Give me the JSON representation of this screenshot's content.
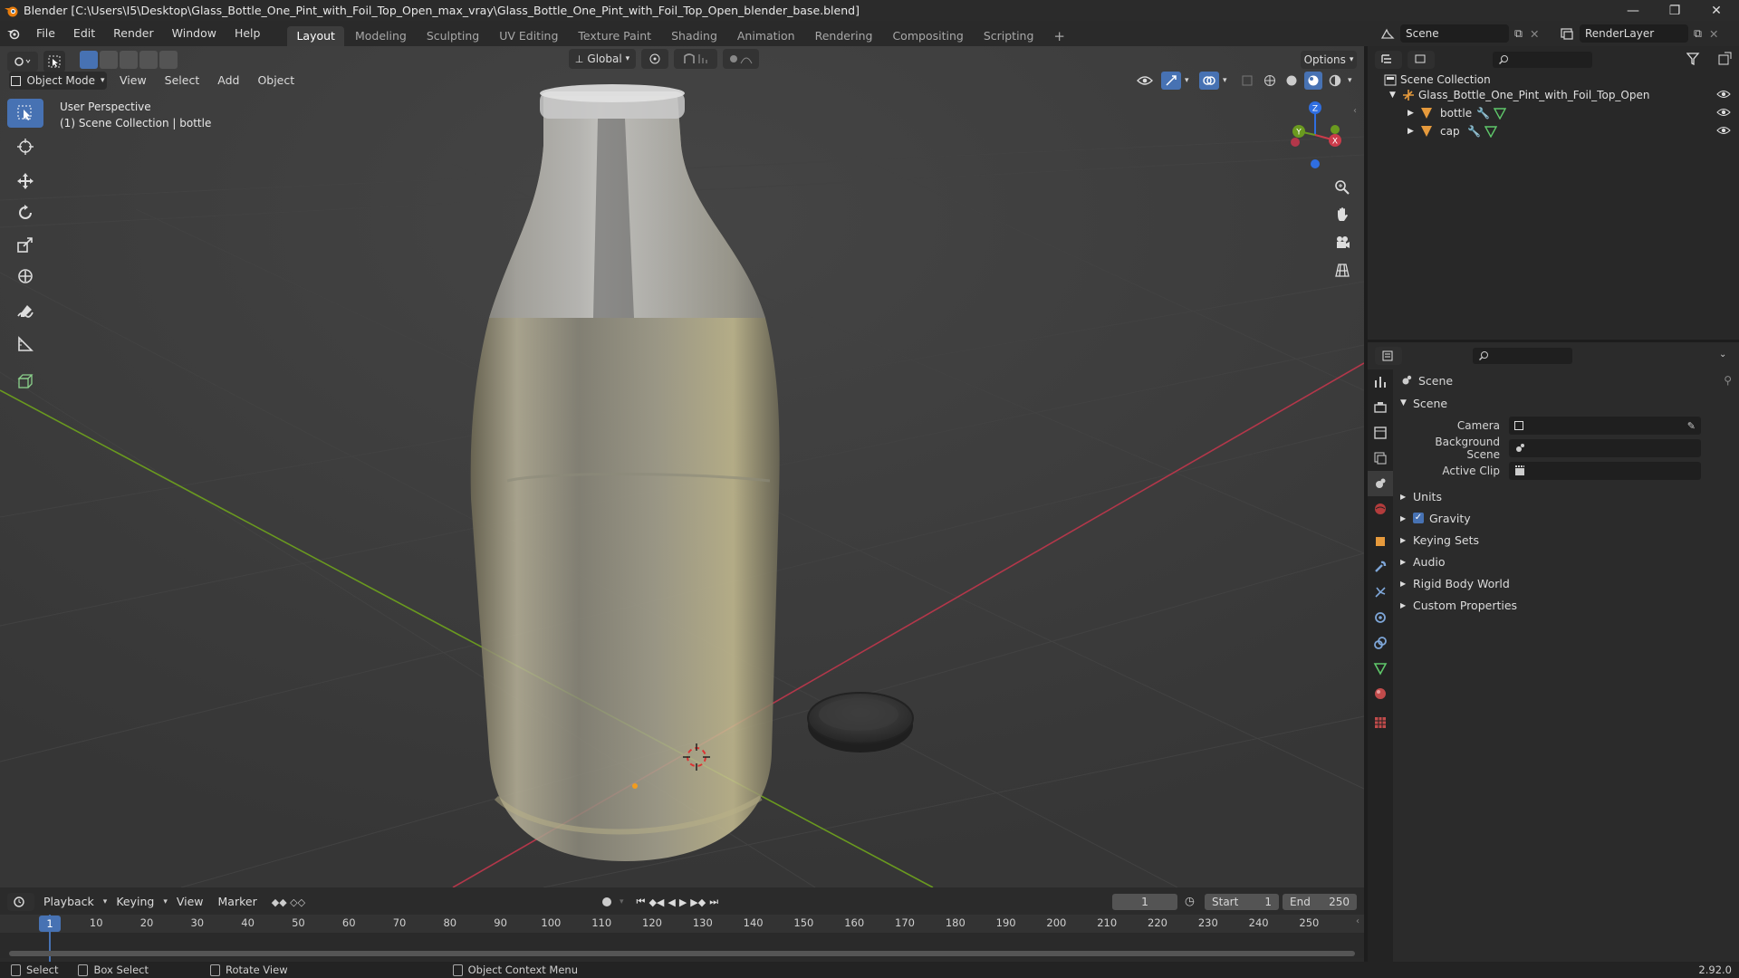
{
  "titlebar": {
    "title": "Blender [C:\\Users\\I5\\Desktop\\Glass_Bottle_One_Pint_with_Foil_Top_Open_max_vray\\Glass_Bottle_One_Pint_with_Foil_Top_Open_blender_base.blend]",
    "minimize": "—",
    "maximize": "❐",
    "close": "✕"
  },
  "menubar": {
    "menus": [
      "File",
      "Edit",
      "Render",
      "Window",
      "Help"
    ],
    "workspaces": [
      "Layout",
      "Modeling",
      "Sculpting",
      "UV Editing",
      "Texture Paint",
      "Shading",
      "Animation",
      "Rendering",
      "Compositing",
      "Scripting"
    ],
    "active_workspace": "Layout",
    "add_workspace": "+",
    "scene_name": "Scene",
    "view_layer": "RenderLayer"
  },
  "viewport": {
    "mode": "Object Mode",
    "menus": [
      "View",
      "Select",
      "Add",
      "Object"
    ],
    "orientation": "Global",
    "options_label": "Options",
    "perspective": "User Perspective",
    "collection_info": "(1) Scene Collection | bottle",
    "gizmo_axes": {
      "x": "X",
      "y": "Y",
      "z": "Z"
    },
    "tools": [
      "select-box",
      "cursor",
      "move",
      "rotate",
      "scale",
      "transform",
      "annotate",
      "measure",
      "add-cube"
    ]
  },
  "outliner": {
    "root": "Scene Collection",
    "collection": "Glass_Bottle_One_Pint_with_Foil_Top_Open",
    "objects": [
      "bottle",
      "cap"
    ]
  },
  "properties": {
    "context": "Scene",
    "panel_title": "Scene",
    "fields": {
      "camera_label": "Camera",
      "background_label": "Background Scene",
      "clip_label": "Active Clip"
    },
    "subpanels": [
      "Units",
      "Gravity",
      "Keying Sets",
      "Audio",
      "Rigid Body World",
      "Custom Properties"
    ],
    "gravity_checked": true
  },
  "timeline": {
    "menus": [
      "Playback",
      "Keying",
      "View",
      "Marker"
    ],
    "current_frame": "1",
    "start_label": "Start",
    "start_value": "1",
    "end_label": "End",
    "end_value": "250",
    "ruler": [
      "1",
      "10",
      "20",
      "30",
      "40",
      "50",
      "60",
      "70",
      "80",
      "90",
      "100",
      "110",
      "120",
      "130",
      "140",
      "150",
      "160",
      "170",
      "180",
      "190",
      "200",
      "210",
      "220",
      "230",
      "240",
      "250"
    ]
  },
  "statusbar": {
    "select": "Select",
    "box_select": "Box Select",
    "rotate_view": "Rotate View",
    "context_menu": "Object Context Menu",
    "version": "2.92.0"
  },
  "colors": {
    "accent": "#4772b3",
    "axis_x": "#cc3b4a",
    "axis_y": "#6a9a1f",
    "axis_z": "#2f6ee0"
  }
}
